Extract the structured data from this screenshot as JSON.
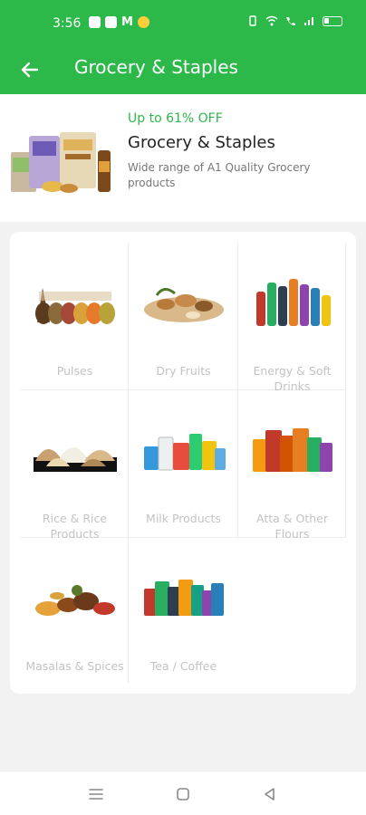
{
  "status_bar": {
    "time": "3:56",
    "app_icons": [
      "gallery-icon",
      "photos-icon",
      "gmail-icon",
      "emoji-icon"
    ],
    "right_icons": [
      "vibrate-icon",
      "wifi-icon",
      "call-icon",
      "signal-icon",
      "battery-icon"
    ]
  },
  "app_bar": {
    "title": "Grocery & Staples",
    "back_icon": "arrow-left-icon"
  },
  "banner": {
    "offer": "Up to 61% OFF",
    "title": "Grocery & Staples",
    "subtitle": "Wide range of A1 Quality Grocery products"
  },
  "categories": [
    {
      "label": "Pulses",
      "icon": "pulses-image"
    },
    {
      "label": "Dry Fruits",
      "icon": "dry-fruits-image"
    },
    {
      "label": "Energy & Soft Drinks",
      "icon": "drinks-image"
    },
    {
      "label": "Rice & Rice Products",
      "icon": "rice-image"
    },
    {
      "label": "Milk Products",
      "icon": "milk-image"
    },
    {
      "label": "Atta & Other Flours",
      "icon": "flour-image"
    },
    {
      "label": "Masalas & Spices",
      "icon": "spices-image"
    },
    {
      "label": "Tea / Coffee",
      "icon": "tea-coffee-image"
    }
  ],
  "nav_bar": {
    "icons": [
      "menu-icon",
      "home-square-icon",
      "back-triangle-icon"
    ]
  },
  "colors": {
    "brand": "#2db84a",
    "background": "#f2f2f2",
    "label_grey": "#c3c3c3"
  }
}
